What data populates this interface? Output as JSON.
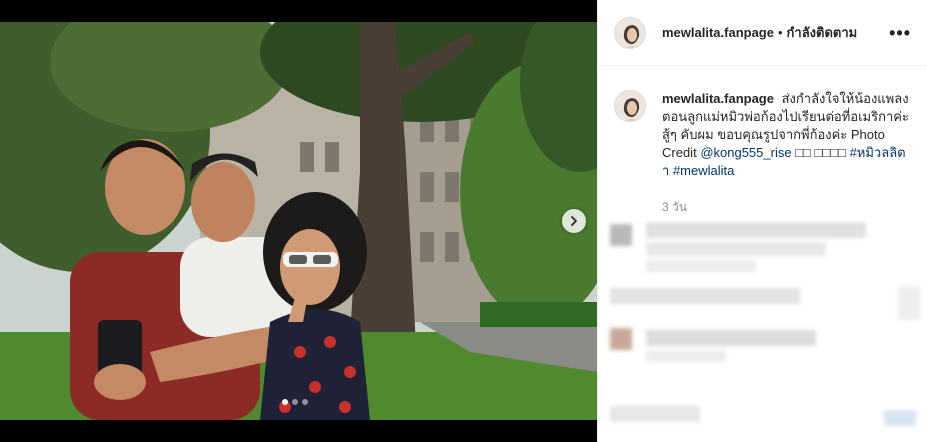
{
  "post": {
    "username": "mewlalita.fanpage",
    "separator": "•",
    "follow_state": "กำลังติดตาม",
    "more_label": "•••",
    "caption_text": "ส่งกำลังใจให้น้องแพลงตอนลูกแม่หมิวพ่อก้องไปเรียนต่อที่อเมริกาค่ะ สู้ๆ คับผม ขอบคุณรูปจากพี่ก้องค่ะ Photo Credit",
    "mention": "@kong555_rise",
    "emoji_text": "□□ □□□□",
    "hashtag1": "#หมิวลลิตา",
    "hashtag2": "#mewlalita",
    "time_ago": "3 วัน"
  },
  "carousel": {
    "slide_count": 3,
    "active_index": 0
  },
  "colors": {
    "link": "#00376b",
    "meta_gray": "#8e8e8e",
    "text": "#262626"
  }
}
